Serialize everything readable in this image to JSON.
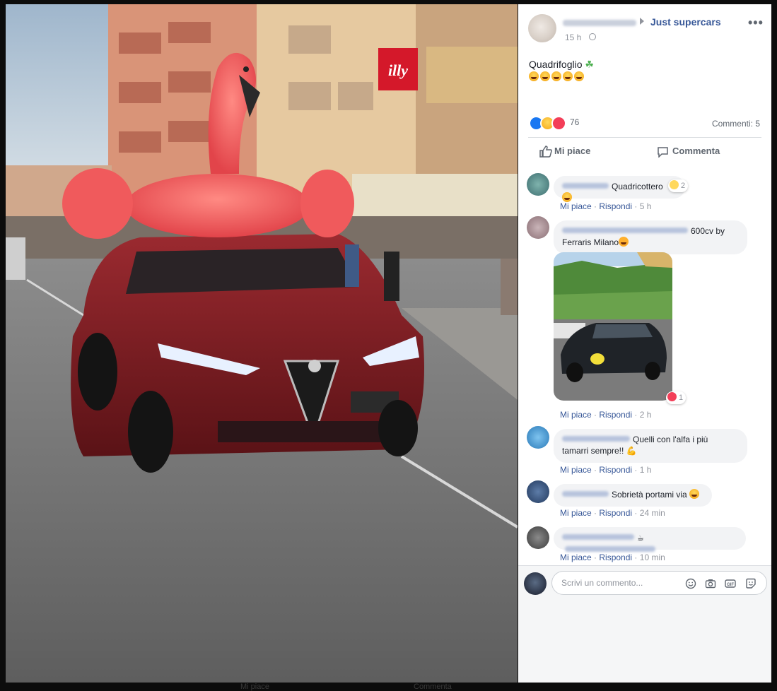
{
  "post": {
    "group_name": "Just supercars",
    "time": "15 h",
    "text_line1": "Quadrifoglio",
    "reaction_count": "76",
    "comments_count": "Commenti: 5",
    "colors": {
      "link": "#385898",
      "panel_bg": "#ffffff",
      "bubble_bg": "#f2f3f5"
    }
  },
  "actions": {
    "like": "Mi piace",
    "comment": "Commenta"
  },
  "photo": {
    "shop_sign": "illy"
  },
  "comments": [
    {
      "text": "Quadricottero",
      "like": "Mi piace",
      "reply": "Rispondi",
      "time": "5 h",
      "reaction_count": "2"
    },
    {
      "text": "600cv by",
      "text2": "Ferraris Milano",
      "like": "Mi piace",
      "reply": "Rispondi",
      "time": "2 h",
      "reaction_count": "1"
    },
    {
      "text": "Quelli con l'alfa i più",
      "text2": "tamarri sempre!!",
      "like": "Mi piace",
      "reply": "Rispondi",
      "time": "1 h"
    },
    {
      "text": "Sobrietà portami via",
      "like": "Mi piace",
      "reply": "Rispondi",
      "time": "24 min"
    },
    {
      "text": "",
      "like": "Mi piace",
      "reply": "Rispondi",
      "time": "10 min"
    }
  ],
  "write": {
    "placeholder": "Scrivi un commento..."
  },
  "ghost": {
    "like": "Mi piace",
    "comment": "Commenta"
  },
  "icons": [
    "globe-icon",
    "more-icon",
    "thumb-up-icon",
    "comment-bubble-icon",
    "emoji-icon",
    "camera-icon",
    "gif-icon",
    "sticker-icon"
  ]
}
